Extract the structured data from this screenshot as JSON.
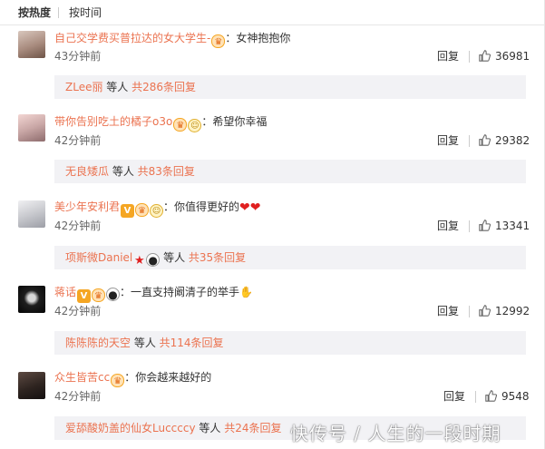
{
  "sort_tabs": {
    "hot": "按热度",
    "time": "按时间"
  },
  "colors": {
    "username": "#eb7350",
    "reply_box_bg": "#f2f2f5"
  },
  "icons": {
    "like": "thumbs-up-icon",
    "vip": "v-badge-icon",
    "member": "member-crown-icon",
    "medal": "medal-icon",
    "panda": "panda-icon",
    "star": "star-icon",
    "heart": "heart-icon"
  },
  "comments": [
    {
      "author": "自己交学费买普拉达的女大学生-",
      "text": "女神抱抱你",
      "time": "43分钟前",
      "reply": "回复",
      "likes": "36981",
      "reply_users": "ZLee丽",
      "reply_mid": " 等人 ",
      "reply_count": "共286条回复"
    },
    {
      "author": "带你告别吃土的橘子o3o",
      "text": "希望你幸福",
      "time": "42分钟前",
      "reply": "回复",
      "likes": "29382",
      "reply_users": "无良矮瓜",
      "reply_mid": " 等人 ",
      "reply_count": "共83条回复"
    },
    {
      "author": "美少年安利君",
      "text": "你值得更好的",
      "time": "42分钟前",
      "reply": "回复",
      "likes": "13341",
      "reply_users": "项斯微Daniel",
      "reply_mid": " 等人 ",
      "reply_count": "共35条回复"
    },
    {
      "author": "蒋话",
      "text": "一直支持阚清子的举手",
      "time": "42分钟前",
      "reply": "回复",
      "likes": "12992",
      "reply_users": "陈陈陈的天空",
      "reply_mid": " 等人 ",
      "reply_count": "共114条回复"
    },
    {
      "author": "众生皆苦cc",
      "text": "你会越来越好的",
      "time": "42分钟前",
      "reply": "回复",
      "likes": "9548",
      "reply_users": "爱舔酸奶盖的仙女Luccccy",
      "reply_mid": " 等人 ",
      "reply_count": "共24条回复"
    }
  ],
  "watermark": "快传号 / 人生的一段时期"
}
